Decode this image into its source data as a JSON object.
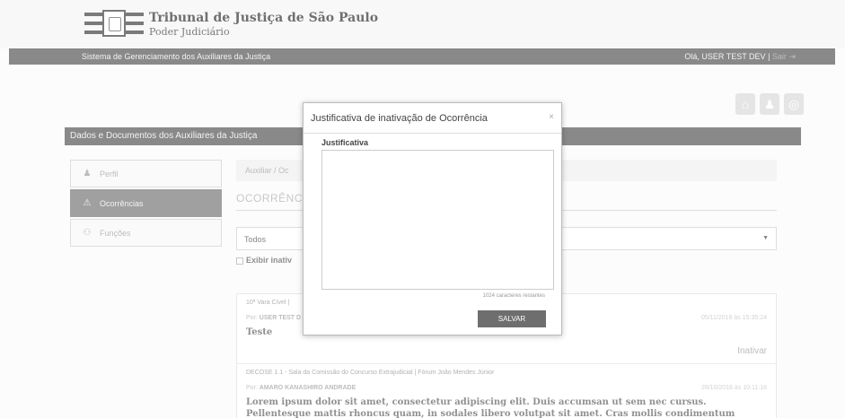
{
  "header": {
    "title": "Tribunal de Justiça de São Paulo",
    "subtitle": "Poder Judiciário"
  },
  "navbar": {
    "system_name": "Sistema de Gerenciamento dos Auxiliares da Justiça",
    "greeting": "Olá, USER TEST DEV",
    "separator": "|",
    "logout_label": "Sair"
  },
  "toolbar_icons": [
    "home-icon",
    "user-icon",
    "settings-icon"
  ],
  "section_title": "Dados e Documentos dos Auxiliares da Justiça",
  "sidebar": {
    "items": [
      {
        "label": "Perfil",
        "icon": "user-icon"
      },
      {
        "label": "Ocorrências",
        "icon": "warning-icon",
        "active": true
      },
      {
        "label": "Funções",
        "icon": "group-icon"
      }
    ]
  },
  "main": {
    "breadcrumb": "Auxiliar / Oc",
    "page_title": "OCORRÊNCIA",
    "filter_select": "Todos",
    "checkbox_label": "Exibir inativ",
    "cards": [
      {
        "org": "10ª Vara Cível |",
        "meta_prefix": "Por:",
        "author": "USER TEST D",
        "date": "05/11/2016 às 15:35:24",
        "description": "Teste",
        "action": "Inativar"
      },
      {
        "org": "DECOSE 1.1 - Sala da Comissão do Concurso Extrajudicial | Fórum João Mendes Júnior",
        "meta_prefix": "Por:",
        "author": "AMARO KANASHIRO ANDRADE",
        "date": "28/10/2016 às 10:11:16",
        "description": "Lorem ipsum dolor sit amet, consectetur adipiscing elit. Duis accumsan ut sem nec cursus. Pellentesque mattis rhoncus quam, in sodales libero volutpat sit amet. Cras mollis condimentum dapibus. Curabitur"
      }
    ]
  },
  "modal": {
    "title": "Justificativa de inativação de Ocorrência",
    "close_label": "×",
    "field_label": "Justificativa",
    "textarea_value": "",
    "char_count": "1024 caracteres restantes",
    "save_label": "SALVAR"
  }
}
